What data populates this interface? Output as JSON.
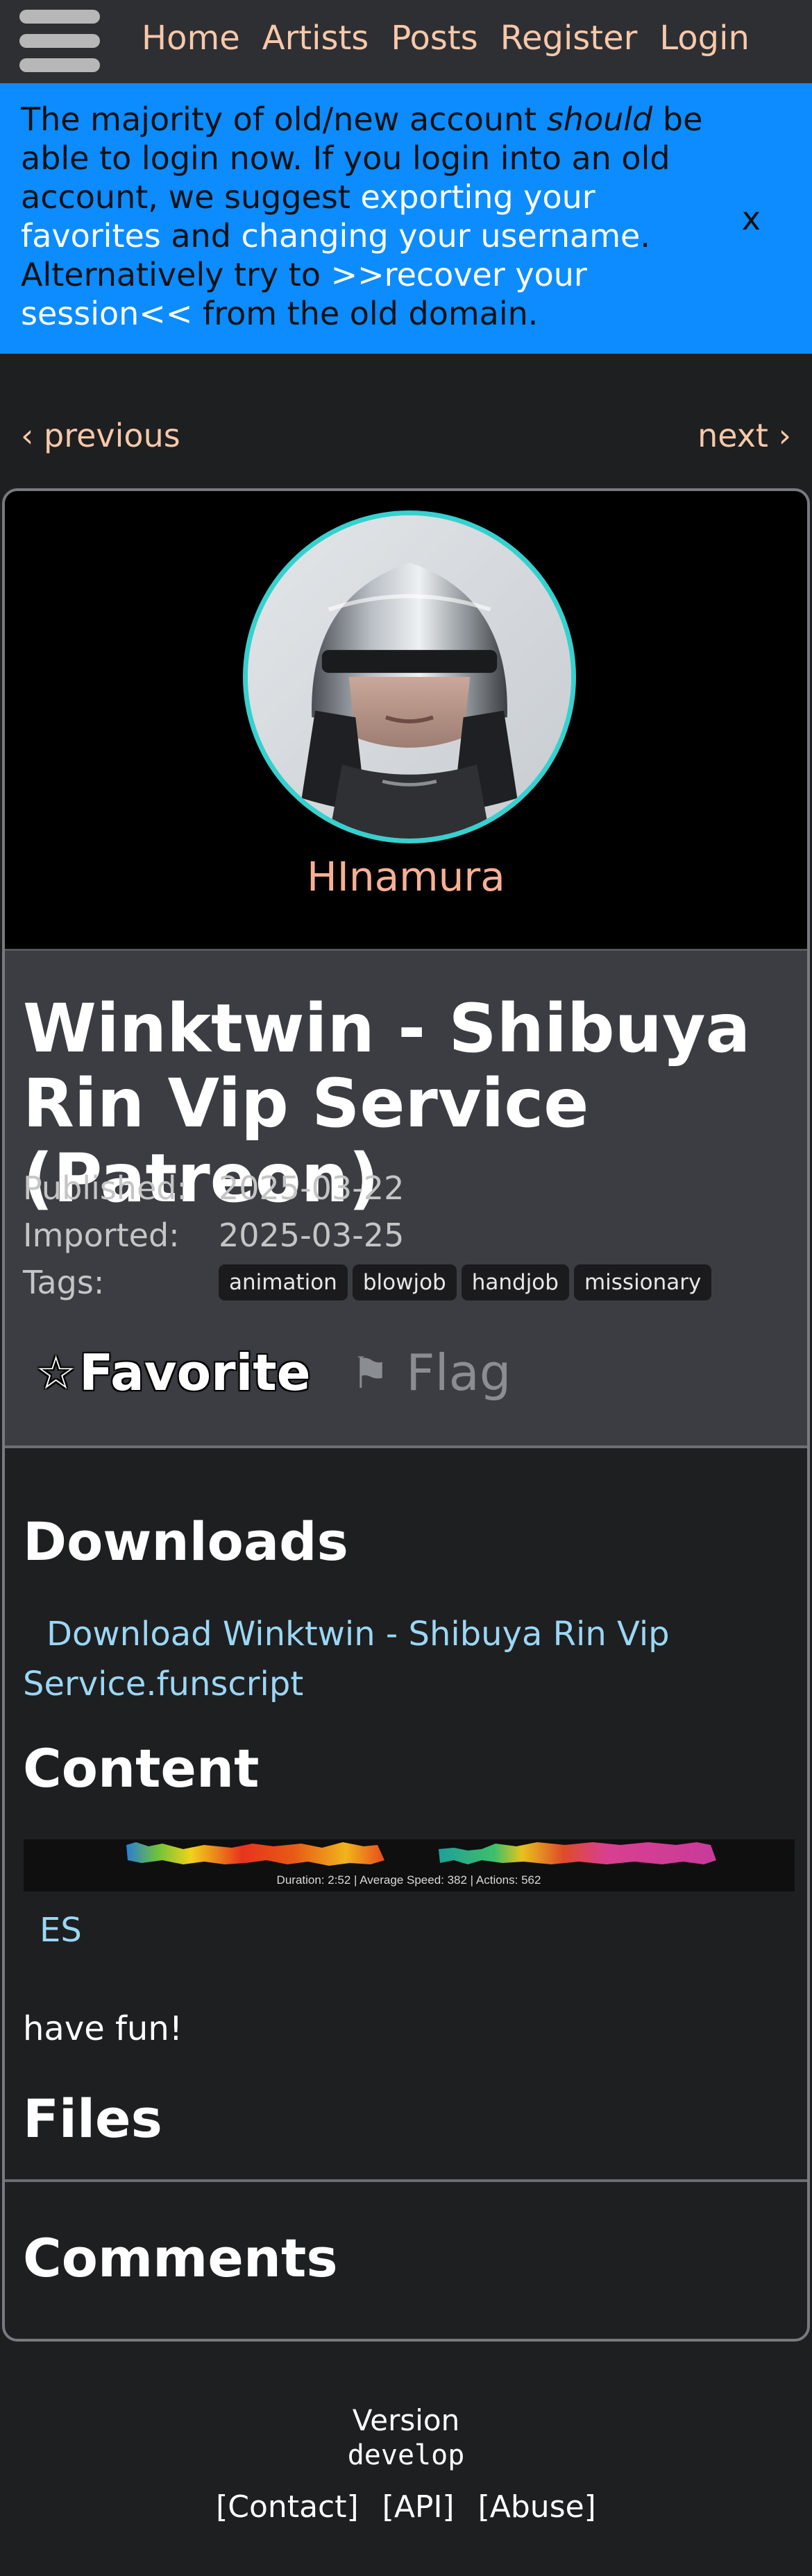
{
  "nav": {
    "menu_icon": "hamburger-menu-icon",
    "links": [
      "Home",
      "Artists",
      "Posts",
      "Register",
      "Login"
    ]
  },
  "announcement": {
    "t1": "The majority of old/new account ",
    "em": "should",
    "t2": " be able to login now. If you login into an old account, we suggest ",
    "link1": "exporting your favorites",
    "t3": " and ",
    "link2": "changing your username",
    "t4": ". Alternatively try to ",
    "link3": ">>recover your session<<",
    "t5": " from the old domain.",
    "close": "x",
    "bg_color": "#0c8cff"
  },
  "pager": {
    "previous": "‹ previous",
    "next": "next ›"
  },
  "artist": {
    "name": "HInamura"
  },
  "post": {
    "title": "Winktwin - Shibuya Rin Vip Service (Patreon)",
    "published_label": "Published:",
    "published": "2025-03-22",
    "imported_label": "Imported:",
    "imported": "2025-03-25",
    "tags_label": "Tags:",
    "tags": [
      "animation",
      "blowjob",
      "handjob",
      "missionary"
    ],
    "favorite": "Favorite",
    "favorite_icon": "star-outline-icon",
    "flag": "Flag",
    "flag_icon": "flag-icon"
  },
  "downloads": {
    "heading": "Downloads",
    "link": "Download Winktwin - Shibuya Rin Vip Service.funscript"
  },
  "content": {
    "heading": "Content",
    "heatmap_caption": "Duration: 2:52   |   Average Speed: 382   |   Actions: 562",
    "link": "ES",
    "text": "have fun!"
  },
  "files": {
    "heading": "Files"
  },
  "comments": {
    "heading": "Comments"
  },
  "footer": {
    "version_label": "Version",
    "version": "develop",
    "links": [
      "[Contact]",
      "[API]",
      "[Abuse]"
    ]
  }
}
